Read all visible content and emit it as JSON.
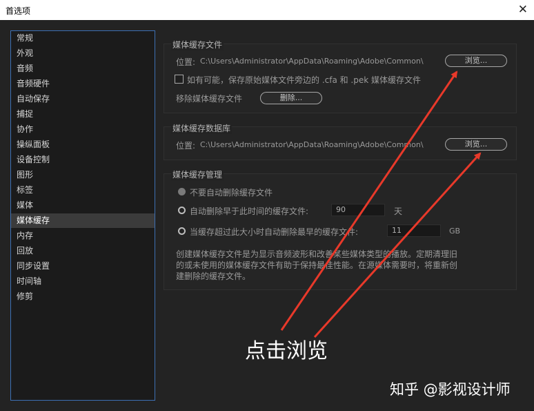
{
  "window": {
    "title": "首选项",
    "close_glyph": "✕"
  },
  "sidebar": {
    "items": [
      {
        "label": "常规"
      },
      {
        "label": "外观"
      },
      {
        "label": "音频"
      },
      {
        "label": "音频硬件"
      },
      {
        "label": "自动保存"
      },
      {
        "label": "捕捉"
      },
      {
        "label": "协作"
      },
      {
        "label": "操纵面板"
      },
      {
        "label": "设备控制"
      },
      {
        "label": "图形"
      },
      {
        "label": "标签"
      },
      {
        "label": "媒体"
      },
      {
        "label": "媒体缓存"
      },
      {
        "label": "内存"
      },
      {
        "label": "回放"
      },
      {
        "label": "同步设置"
      },
      {
        "label": "时间轴"
      },
      {
        "label": "修剪"
      }
    ],
    "selected": "媒体缓存"
  },
  "media_cache_files": {
    "title": "媒体缓存文件",
    "location_label": "位置:",
    "location_path": "C:\\Users\\Administrator\\AppData\\Roaming\\Adobe\\Common\\",
    "browse_label": "浏览...",
    "save_beside_label": "如有可能，保存原始媒体文件旁边的 .cfa 和 .pek 媒体缓存文件",
    "save_beside_checked": false,
    "remove_label": "移除媒体缓存文件",
    "delete_label": "删除..."
  },
  "media_cache_db": {
    "title": "媒体缓存数据库",
    "location_label": "位置:",
    "location_path": "C:\\Users\\Administrator\\AppData\\Roaming\\Adobe\\Common\\",
    "browse_label": "浏览..."
  },
  "media_cache_mgmt": {
    "title": "媒体缓存管理",
    "option_none": "不要自动删除缓存文件",
    "option_older": "自动删除早于此时间的缓存文件:",
    "older_value": "90",
    "older_unit": "天",
    "option_larger": "当缓存超过此大小时自动删除最早的缓存文件:",
    "larger_value": "11",
    "larger_unit": "GB",
    "description": "创建媒体缓存文件是为显示音频波形和改善某些媒体类型的播放。定期清理旧的或未使用的媒体缓存文件有助于保持最佳性能。在源媒体需要时，将重新创建删除的缓存文件。"
  },
  "annotation": {
    "text": "点击浏览",
    "arrow_color": "#e8392a"
  },
  "watermark": "知乎 @影视设计师"
}
